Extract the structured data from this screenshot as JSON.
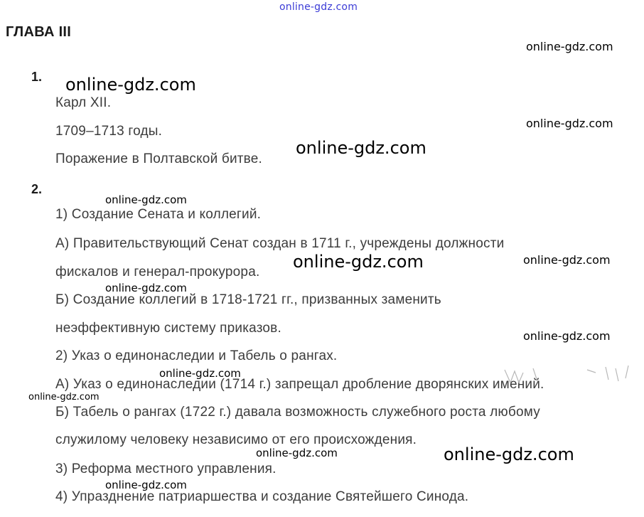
{
  "watermark": "online-gdz.com",
  "chapter_title": "ГЛАВА III",
  "q1": {
    "number": "1.",
    "lines": [
      "Карл XII.",
      "1709–1713 годы.",
      "Поражение в Полтавской битве."
    ]
  },
  "q2": {
    "number": "2.",
    "lines": [
      "1) Создание Сената и коллегий.",
      "А) Правительствующий Сенат создан в 1711 г., учреждены должности",
      "фискалов и генерал-прокурора.",
      "Б) Создание коллегий в 1718-1721 гг., призванных заменить",
      "неэффективную систему приказов.",
      "2) Указ о единонаследии и Табель о рангах.",
      "А) Указ о единонаследии (1714 г.) запрещал дробление дворянских имений.",
      "Б) Табель о рангах (1722 г.) давала возможность служебного роста любому",
      "служилому человеку независимо от его происхождения.",
      "3) Реформа местного управления.",
      "4) Упразднение патриаршества и создание Святейшего Синода."
    ]
  }
}
